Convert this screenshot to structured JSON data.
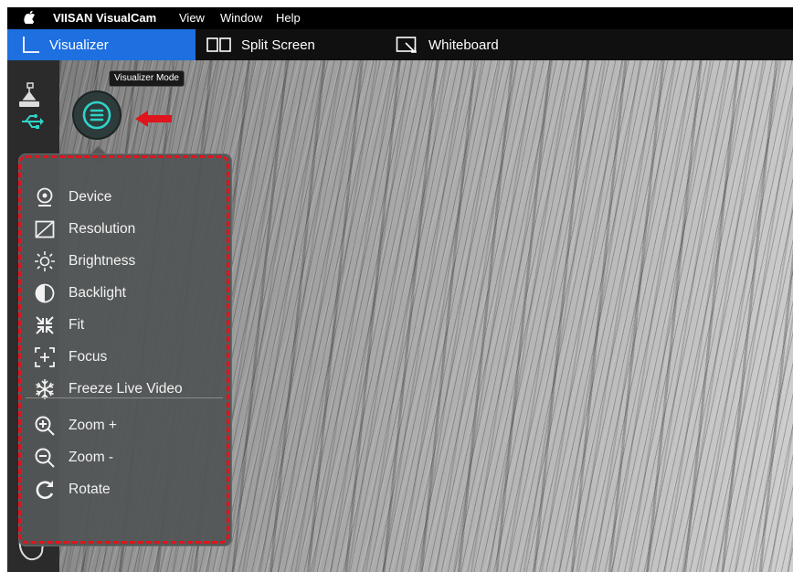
{
  "menubar": {
    "apple_icon": "apple-logo",
    "app_name": "VIISAN VisualCam",
    "items": [
      "View",
      "Window",
      "Help"
    ]
  },
  "tabs": [
    {
      "label": "Visualizer",
      "icon": "visualizer-icon",
      "active": true
    },
    {
      "label": "Split Screen",
      "icon": "split-screen-icon",
      "active": false
    },
    {
      "label": "Whiteboard",
      "icon": "whiteboard-icon",
      "active": false
    }
  ],
  "tooltip": "Visualizer Mode",
  "menu": {
    "items": [
      {
        "label": "Device",
        "icon": "webcam-icon"
      },
      {
        "label": "Resolution",
        "icon": "resolution-icon"
      },
      {
        "label": "Brightness",
        "icon": "brightness-icon"
      },
      {
        "label": "Backlight",
        "icon": "backlight-icon"
      },
      {
        "label": "Fit",
        "icon": "fit-icon"
      },
      {
        "label": "Focus",
        "icon": "focus-icon"
      },
      {
        "label": "Freeze Live Video",
        "icon": "snowflake-icon"
      },
      {
        "label": "Zoom +",
        "icon": "zoom-in-icon"
      },
      {
        "label": "Zoom -",
        "icon": "zoom-out-icon"
      },
      {
        "label": "Rotate",
        "icon": "rotate-icon"
      }
    ]
  },
  "colors": {
    "active_tab": "#1e6fe0",
    "accent": "#2fd3c8",
    "annotation": "#e0141c"
  }
}
